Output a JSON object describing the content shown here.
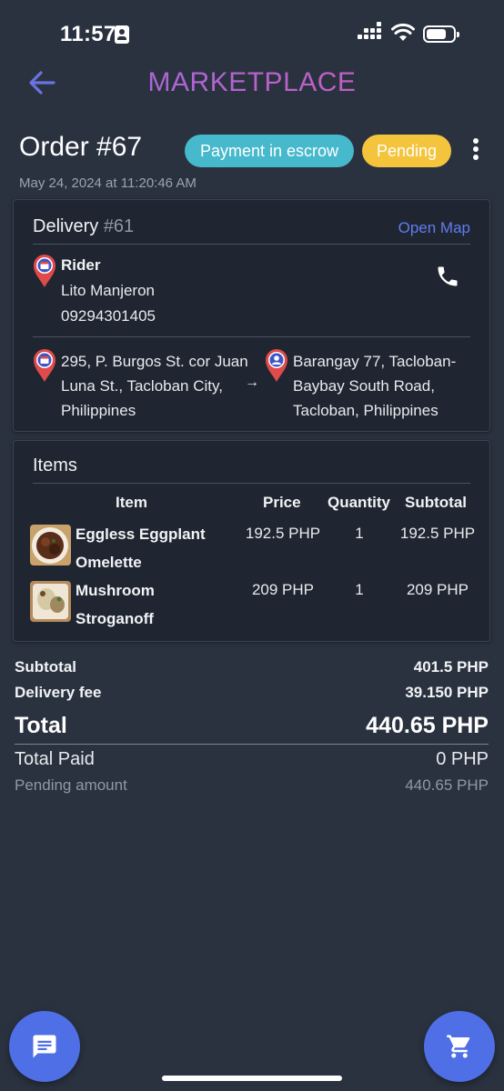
{
  "status_bar": {
    "time": "11:57"
  },
  "header": {
    "title": "MARKETPLACE"
  },
  "order": {
    "title": "Order #67",
    "payment_badge": "Payment in escrow",
    "status_badge": "Pending",
    "date": "May 24, 2024 at 11:20:46 AM"
  },
  "delivery": {
    "title": "Delivery",
    "number": "#61",
    "open_map": "Open Map",
    "rider_label": "Rider",
    "rider_name": "Lito Manjeron",
    "rider_phone": "09294301405",
    "from_address": "295, P. Burgos St. cor Juan Luna St., Tacloban City, Philippines",
    "to_address": "Barangay 77, Tacloban-Baybay South Road, Tacloban, Philippines",
    "arrow": "→"
  },
  "items": {
    "title": "Items",
    "headers": {
      "item": "Item",
      "price": "Price",
      "quantity": "Quantity",
      "subtotal": "Subtotal"
    },
    "rows": [
      {
        "name": "Eggless Eggplant Omelette",
        "price": "192.5 PHP",
        "quantity": "1",
        "subtotal": "192.5 PHP"
      },
      {
        "name": "Mushroom Stroganoff",
        "price": "209 PHP",
        "quantity": "1",
        "subtotal": "209 PHP"
      }
    ]
  },
  "summary": {
    "subtotal_label": "Subtotal",
    "subtotal_value": "401.5 PHP",
    "delivery_fee_label": "Delivery fee",
    "delivery_fee_value": "39.150 PHP",
    "total_label": "Total",
    "total_value": "440.65 PHP",
    "total_paid_label": "Total Paid",
    "total_paid_value": "0 PHP",
    "pending_label": "Pending amount",
    "pending_value": "440.65 PHP"
  },
  "colors": {
    "background": "#2a3240",
    "card": "#1f2631",
    "accent": "#4f6fe6",
    "escrow_badge": "#47b9cc",
    "pending_badge": "#f4c43d",
    "title_gradient_start": "#9b6ce2",
    "title_gradient_end": "#d05ab6"
  },
  "icons": [
    "back-arrow-icon",
    "more-vert-icon",
    "store-pin-icon",
    "person-pin-icon",
    "phone-icon",
    "chat-icon",
    "cart-icon"
  ]
}
